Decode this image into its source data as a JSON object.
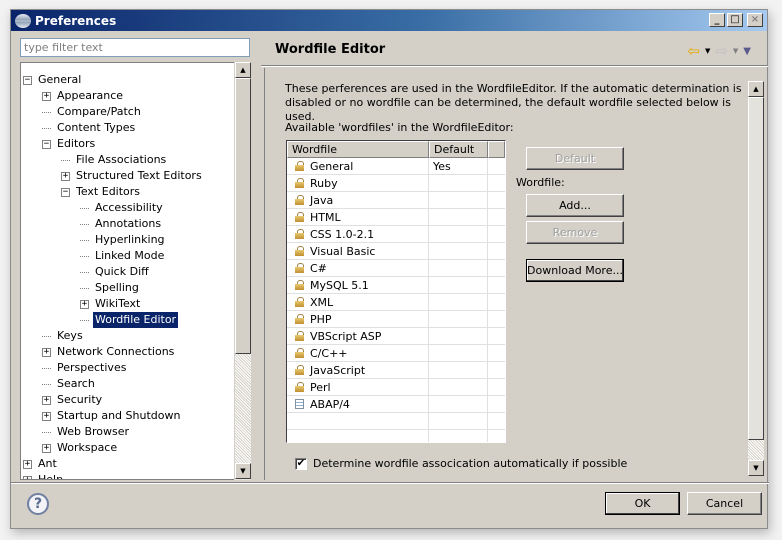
{
  "window": {
    "title": "Preferences",
    "controls": {
      "minimize": "_",
      "maximize": "□",
      "close": "×"
    }
  },
  "filter": {
    "placeholder": "type filter text",
    "value": ""
  },
  "tree": {
    "items": [
      {
        "label": "General",
        "level": 0,
        "expander": "minus"
      },
      {
        "label": "Appearance",
        "level": 1,
        "expander": "plus"
      },
      {
        "label": "Compare/Patch",
        "level": 1,
        "expander": "none"
      },
      {
        "label": "Content Types",
        "level": 1,
        "expander": "none"
      },
      {
        "label": "Editors",
        "level": 1,
        "expander": "minus"
      },
      {
        "label": "File Associations",
        "level": 2,
        "expander": "none"
      },
      {
        "label": "Structured Text Editors",
        "level": 2,
        "expander": "plus"
      },
      {
        "label": "Text Editors",
        "level": 2,
        "expander": "minus"
      },
      {
        "label": "Accessibility",
        "level": 3,
        "expander": "none"
      },
      {
        "label": "Annotations",
        "level": 3,
        "expander": "none"
      },
      {
        "label": "Hyperlinking",
        "level": 3,
        "expander": "none"
      },
      {
        "label": "Linked Mode",
        "level": 3,
        "expander": "none"
      },
      {
        "label": "Quick Diff",
        "level": 3,
        "expander": "none"
      },
      {
        "label": "Spelling",
        "level": 3,
        "expander": "none"
      },
      {
        "label": "WikiText",
        "level": 3,
        "expander": "plus"
      },
      {
        "label": "Wordfile Editor",
        "level": 3,
        "expander": "none",
        "selected": true
      },
      {
        "label": "Keys",
        "level": 1,
        "expander": "none"
      },
      {
        "label": "Network Connections",
        "level": 1,
        "expander": "plus"
      },
      {
        "label": "Perspectives",
        "level": 1,
        "expander": "none"
      },
      {
        "label": "Search",
        "level": 1,
        "expander": "none"
      },
      {
        "label": "Security",
        "level": 1,
        "expander": "plus"
      },
      {
        "label": "Startup and Shutdown",
        "level": 1,
        "expander": "plus"
      },
      {
        "label": "Web Browser",
        "level": 1,
        "expander": "none"
      },
      {
        "label": "Workspace",
        "level": 1,
        "expander": "plus"
      },
      {
        "label": "Ant",
        "level": 0,
        "expander": "plus"
      },
      {
        "label": "Help",
        "level": 0,
        "expander": "plus"
      }
    ]
  },
  "page": {
    "title": "Wordfile Editor",
    "nav": {
      "back": "⇦",
      "forward": "⇨",
      "dropdown": "▼",
      "menu": "▼"
    },
    "description": "These perferences are used in the WordfileEditor. If the automatic determination is disabled or no wordfile can be determined, the default wordfile selected below is used.",
    "available_label": "Available 'wordfiles' in the WordfileEditor:",
    "table": {
      "columns": [
        "Wordfile",
        "Default",
        ""
      ],
      "rows": [
        {
          "name": "General",
          "default": "Yes",
          "icon": "lock-icon"
        },
        {
          "name": "Ruby",
          "default": "",
          "icon": "lock-icon"
        },
        {
          "name": "Java",
          "default": "",
          "icon": "lock-icon"
        },
        {
          "name": "HTML",
          "default": "",
          "icon": "lock-icon"
        },
        {
          "name": "CSS 1.0-2.1",
          "default": "",
          "icon": "lock-icon"
        },
        {
          "name": "Visual Basic",
          "default": "",
          "icon": "lock-icon"
        },
        {
          "name": "C#",
          "default": "",
          "icon": "lock-icon"
        },
        {
          "name": "MySQL 5.1",
          "default": "",
          "icon": "lock-icon"
        },
        {
          "name": "XML",
          "default": "",
          "icon": "lock-icon"
        },
        {
          "name": "PHP",
          "default": "",
          "icon": "lock-icon"
        },
        {
          "name": "VBScript ASP",
          "default": "",
          "icon": "lock-icon"
        },
        {
          "name": "C/C++",
          "default": "",
          "icon": "lock-icon"
        },
        {
          "name": "JavaScript",
          "default": "",
          "icon": "lock-icon"
        },
        {
          "name": "Perl",
          "default": "",
          "icon": "lock-icon"
        },
        {
          "name": "ABAP/4",
          "default": "",
          "icon": "file-icon"
        }
      ]
    },
    "buttons": {
      "default": "Default",
      "wordfile_label": "Wordfile:",
      "add": "Add...",
      "remove": "Remove",
      "download": "Download More..."
    },
    "checkbox": {
      "label": "Determine wordfile assocication automatically if possible",
      "checked": true,
      "mark": "✔"
    }
  },
  "footer": {
    "help": "?",
    "ok": "OK",
    "cancel": "Cancel"
  }
}
